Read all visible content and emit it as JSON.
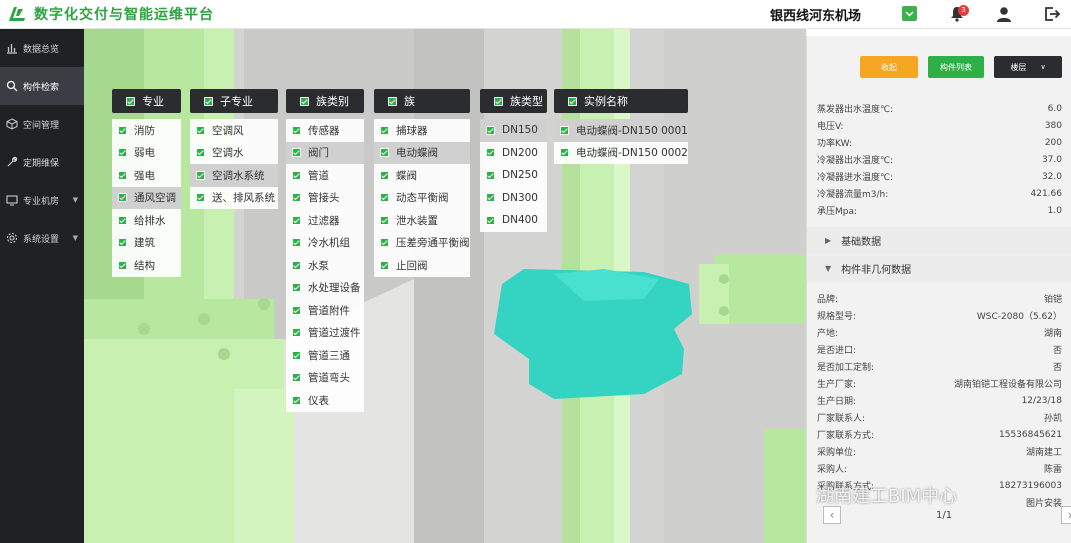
{
  "header": {
    "title": "数字化交付与智能运维平台",
    "site": "银西线河东机场",
    "notification_count": "3",
    "icons": [
      "logo-icon",
      "dropdown-icon",
      "bell-icon",
      "user-icon",
      "logout-icon"
    ]
  },
  "sidebar": {
    "items": [
      {
        "label": "数据总览",
        "icon": "chart-icon",
        "active": false
      },
      {
        "label": "构件检索",
        "icon": "search-icon",
        "active": true
      },
      {
        "label": "空间管理",
        "icon": "cube-icon",
        "active": false
      },
      {
        "label": "定期维保",
        "icon": "wrench-icon",
        "active": false
      },
      {
        "label": "专业机房",
        "icon": "monitor-icon",
        "active": false,
        "caret": true
      },
      {
        "label": "系统设置",
        "icon": "gear-icon",
        "active": false,
        "caret": true
      }
    ]
  },
  "filters": {
    "major": {
      "title": "专业",
      "items": [
        "消防",
        "弱电",
        "强电",
        "通风空调",
        "给排水",
        "建筑",
        "结构"
      ],
      "selected": 3
    },
    "sub": {
      "title": "子专业",
      "items": [
        "空调风",
        "空调水",
        "空调水系统",
        "送、排风系统"
      ],
      "selected": 2
    },
    "category": {
      "title": "族类别",
      "items": [
        "传感器",
        "阀门",
        "管道",
        "管接头",
        "过滤器",
        "冷水机组",
        "水泵",
        "水处理设备",
        "管道附件",
        "管道过渡件",
        "管道三通",
        "管道弯头",
        "仪表"
      ],
      "selected": 1
    },
    "family": {
      "title": "族",
      "items": [
        "捕球器",
        "电动蝶阀",
        "蝶阀",
        "动态平衡阀",
        "泄水装置",
        "压差旁通平衡阀",
        "止回阀"
      ],
      "selected": 1
    },
    "type": {
      "title": "族类型",
      "items": [
        "DN150",
        "DN200",
        "DN250",
        "DN300",
        "DN400"
      ],
      "selected": 0
    },
    "instance": {
      "title": "实例名称",
      "items": [
        "电动蝶阀-DN150 0001",
        "电动蝶阀-DN150 0002"
      ],
      "selected": 0
    }
  },
  "right_panel": {
    "buttons": {
      "collapse": "收起",
      "component_list": "构件列表",
      "floor": "楼层"
    },
    "props_top": [
      {
        "k": "蒸发器出水温度℃:",
        "v": "6.0"
      },
      {
        "k": "电压V:",
        "v": "380"
      },
      {
        "k": "功率KW:",
        "v": "200"
      },
      {
        "k": "冷凝器出水温度℃:",
        "v": "37.0"
      },
      {
        "k": "冷凝器进水温度℃:",
        "v": "32.0"
      },
      {
        "k": "冷凝器流量m3/h:",
        "v": "421.66"
      },
      {
        "k": "承压Mpa:",
        "v": "1.0"
      }
    ],
    "section_basic": "基础数据",
    "section_nongeo": "构件非几何数据",
    "props_bottom": [
      {
        "k": "品牌:",
        "v": "铂铠"
      },
      {
        "k": "规格型号:",
        "v": "WSC-2080（5.62）"
      },
      {
        "k": "产地:",
        "v": "湖南"
      },
      {
        "k": "是否进口:",
        "v": "否"
      },
      {
        "k": "是否加工定制:",
        "v": "否"
      },
      {
        "k": "生产厂家:",
        "v": "湖南铂铠工程设备有限公司"
      },
      {
        "k": "生产日期:",
        "v": "12/23/18"
      },
      {
        "k": "厂家联系人:",
        "v": "孙凯"
      },
      {
        "k": "厂家联系方式:",
        "v": "15536845621"
      },
      {
        "k": "采购单位:",
        "v": "湖南建工"
      },
      {
        "k": "采购人:",
        "v": "陈雷"
      },
      {
        "k": "采购联系方式:",
        "v": "18273196003"
      },
      {
        "k": "",
        "v": "图片安装"
      }
    ],
    "pager": "1/1"
  },
  "watermark": "湖南建工BIM中心",
  "colors": {
    "accent": "#2db047",
    "pipe": "#c8f0b0",
    "valve": "#35d4c2",
    "dark": "#2a2c30",
    "orange": "#f5a623"
  }
}
